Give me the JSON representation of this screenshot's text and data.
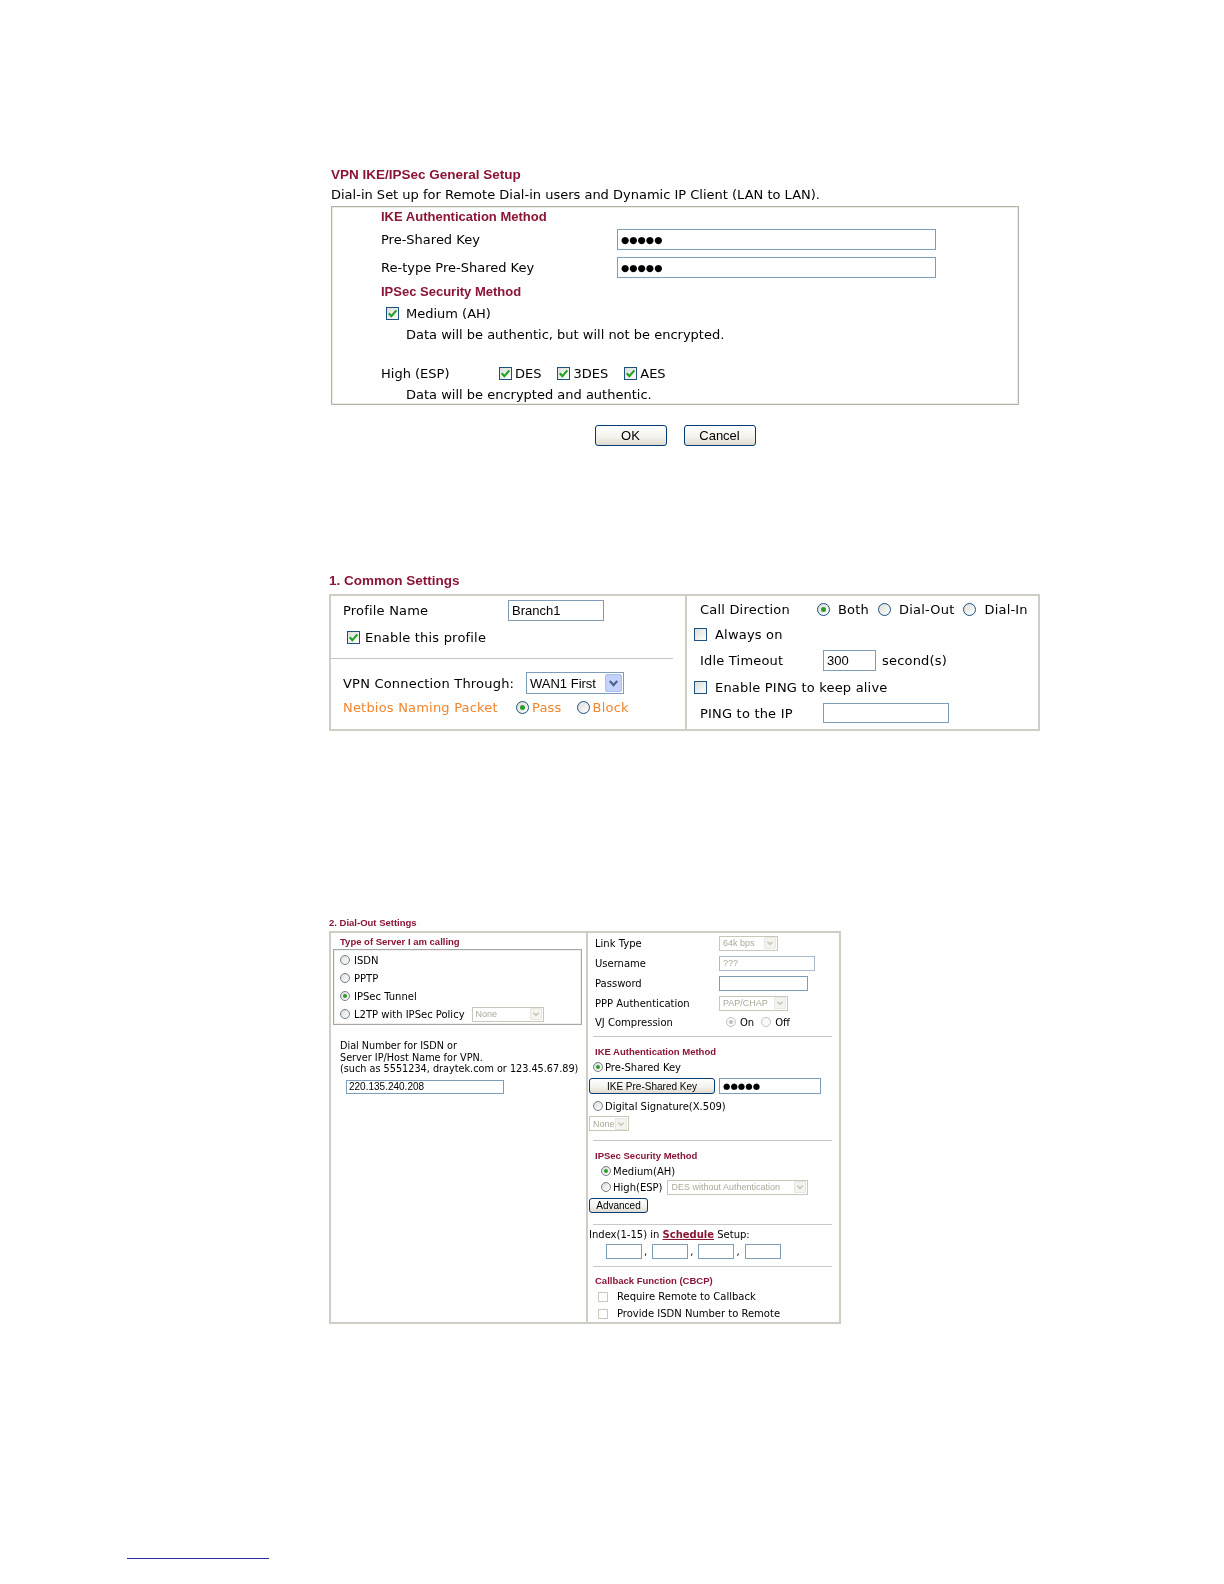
{
  "general_setup": {
    "title": "VPN IKE/IPSec General Setup",
    "description": "Dial-in Set up for Remote Dial-in users and Dynamic IP Client (LAN to LAN).",
    "ike_heading": "IKE Authentication Method",
    "key_fields": [
      {
        "label": "Pre-Shared Key",
        "value": "●●●●●"
      },
      {
        "label": "Re-type Pre-Shared Key",
        "value": "●●●●●"
      }
    ],
    "ipsec_heading": "IPSec Security Method",
    "medium": {
      "label": "Medium (AH)",
      "checked": true,
      "note": "Data will be authentic, but will not be encrypted."
    },
    "high": {
      "label": "High (ESP)",
      "options": [
        {
          "label": "DES",
          "checked": true
        },
        {
          "label": "3DES",
          "checked": true
        },
        {
          "label": "AES",
          "checked": true
        }
      ],
      "note": "Data will be encrypted and authentic."
    },
    "buttons": [
      {
        "label": "OK"
      },
      {
        "label": "Cancel"
      }
    ]
  },
  "common_settings": {
    "title": "1. Common Settings",
    "profile_name": {
      "label": "Profile Name",
      "value": "Branch1"
    },
    "enable_profile": {
      "label": "Enable this profile",
      "checked": true
    },
    "vpn_connection": {
      "label": "VPN Connection Through:",
      "value": "WAN1 First"
    },
    "netbios": {
      "label": "Netbios Naming Packet",
      "options": [
        {
          "label": "Pass",
          "selected": true
        },
        {
          "label": "Block",
          "selected": false
        }
      ]
    },
    "call_direction": {
      "label": "Call Direction",
      "options": [
        {
          "label": "Both",
          "selected": true
        },
        {
          "label": "Dial-Out",
          "selected": false
        },
        {
          "label": "Dial-In",
          "selected": false
        }
      ]
    },
    "always_on": {
      "label": "Always on",
      "checked": false
    },
    "idle_timeout": {
      "label": "Idle Timeout",
      "value": "300",
      "unit": "second(s)"
    },
    "enable_ping": {
      "label": "Enable PING to keep alive",
      "checked": false
    },
    "ping_ip": {
      "label": "PING to the IP"
    }
  },
  "dial_out_settings": {
    "title": "2. Dial-Out Settings",
    "server_type": {
      "heading": "Type of Server I am calling",
      "options": [
        {
          "label": "ISDN",
          "selected": false
        },
        {
          "label": "PPTP",
          "selected": false
        },
        {
          "label": "IPSec Tunnel",
          "selected": true
        },
        {
          "label": "L2TP with IPSec Policy",
          "selected": false,
          "policy": {
            "value": "None",
            "disabled": true
          }
        }
      ]
    },
    "dial_number": {
      "lines": [
        "Dial Number for ISDN or",
        "Server IP/Host Name for VPN.",
        "(such as 5551234, draytek.com or 123.45.67.89)"
      ],
      "value": "220.135.240.208"
    },
    "link_fields": [
      {
        "kind": "select",
        "label": "Link Type",
        "value": "64k bps",
        "disabled": true
      },
      {
        "kind": "input",
        "label": "Username",
        "value": "???",
        "disabled": true
      },
      {
        "kind": "input",
        "label": "Password",
        "disabled": false
      },
      {
        "kind": "select",
        "label": "PPP Authentication",
        "value": "PAP/CHAP",
        "disabled": true
      },
      {
        "kind": "radios",
        "label": "VJ Compression",
        "disabled": true,
        "options": [
          {
            "label": "On",
            "selected": true
          },
          {
            "label": "Off",
            "selected": false
          }
        ]
      }
    ],
    "ike": {
      "heading": "IKE Authentication Method",
      "options": [
        {
          "label": "Pre-Shared Key",
          "selected": true,
          "key_button": "IKE Pre-Shared Key",
          "key_value": "●●●●●"
        },
        {
          "label": "Digital Signature(X.509)",
          "selected": false,
          "certificate": {
            "value": "None",
            "disabled": true
          }
        }
      ]
    },
    "ipsec": {
      "heading": "IPSec Security Method",
      "options": [
        {
          "label": "Medium(AH)",
          "selected": true
        },
        {
          "label": "High(ESP)",
          "selected": false,
          "mode": {
            "value": "DES without Authentication",
            "disabled": true
          }
        }
      ],
      "advanced_button": "Advanced"
    },
    "schedule": {
      "prefix": "Index(1-15) in",
      "link": "Schedule",
      "suffix": "Setup:",
      "separators": [
        ",",
        ",",
        ","
      ]
    },
    "callback": {
      "heading": "Callback Function (CBCP)",
      "options": [
        {
          "label": "Require Remote to Callback",
          "checked": false,
          "disabled": true
        },
        {
          "label": "Provide ISDN Number to Remote",
          "checked": false,
          "disabled": true
        }
      ]
    }
  }
}
